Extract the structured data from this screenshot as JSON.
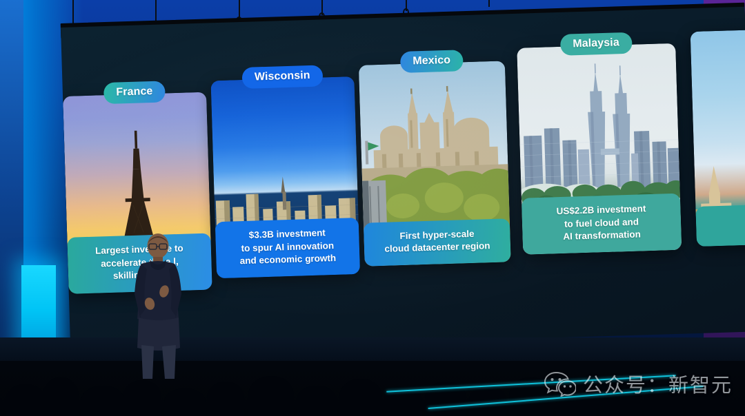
{
  "scene": {
    "type": "conference-keynote-stage",
    "venue_lighting": "blue stage backdrop with cyan light strip",
    "watermark": {
      "text": "公众号：新智元",
      "logo": "wechat-icon"
    }
  },
  "slide": {
    "background_color": "#0a1d2b",
    "panel_right_color": "#4a1f86",
    "cards": [
      {
        "id": "france",
        "label": "France",
        "pill_gradient": [
          "#2bb9a6",
          "#2f86e0"
        ],
        "caption_gradient": [
          "#2aa99c",
          "#2b8de6"
        ],
        "caption_lines": [
          "Largest investme          to",
          "accelerate the a          l,",
          "skilling, and"
        ],
        "caption_note": "partially occluded by speaker",
        "photo": "eiffel-tower-sunset"
      },
      {
        "id": "wisconsin",
        "label": "Wisconsin",
        "pill_gradient": [
          "#1367e8",
          "#1367e8"
        ],
        "caption_gradient": [
          "#1274e8",
          "#1274e8"
        ],
        "caption_lines": [
          "$3.3B investment",
          "to spur AI innovation",
          "and economic growth"
        ],
        "photo": "milwaukee-skyline"
      },
      {
        "id": "mexico",
        "label": "Mexico",
        "pill_gradient": [
          "#2f86e0",
          "#2bb3a8"
        ],
        "caption_gradient": [
          "#1f86dd",
          "#2fae9f"
        ],
        "caption_lines": [
          "First hyper-scale",
          "cloud datacenter region"
        ],
        "photo": "guadalajara-cathedral"
      },
      {
        "id": "malaysia",
        "label": "Malaysia",
        "pill_gradient": [
          "#3aada2",
          "#3aada2"
        ],
        "caption_gradient": [
          "#3fa89d",
          "#3fa89d"
        ],
        "caption_lines": [
          "US$2.2B investment",
          "to fuel cloud and",
          "AI transformation"
        ],
        "photo": "kuala-lumpur-skyline"
      },
      {
        "id": "partial",
        "label": "",
        "pill_gradient": [
          "#3aada2",
          "#3aada2"
        ],
        "caption_gradient": [
          "#2fa59c",
          "#2fa59c"
        ],
        "caption_lines": [],
        "caption_note": "card cut off at right edge of frame",
        "photo": "temple-waterfront"
      }
    ]
  },
  "speaker": {
    "description": "presenter standing at center-left of stage",
    "attire_color": "#151b2e"
  }
}
